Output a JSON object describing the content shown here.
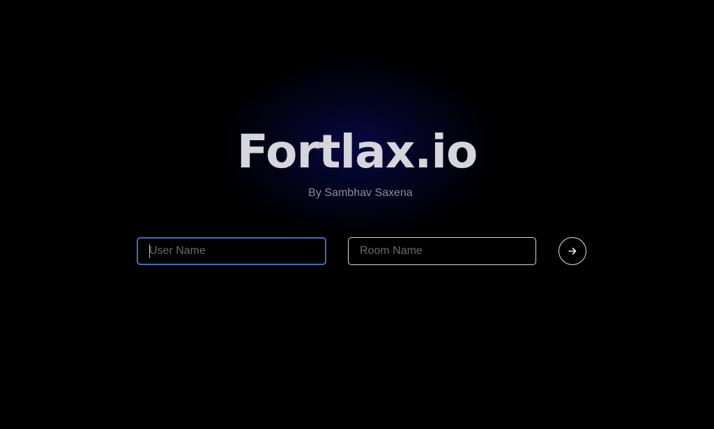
{
  "hero": {
    "title": "Fortlax.io",
    "subtitle": "By Sambhav Saxena"
  },
  "form": {
    "username": {
      "placeholder": "User Name",
      "value": ""
    },
    "roomname": {
      "placeholder": "Room Name",
      "value": ""
    },
    "submit_icon": "arrow-right-icon"
  },
  "colors": {
    "background": "#000000",
    "glow": "#08084a",
    "title": "#d6d5dc",
    "subtitle": "#8c8c93",
    "focus_border": "#3a6fc4",
    "field_border": "#d8d8d8"
  }
}
